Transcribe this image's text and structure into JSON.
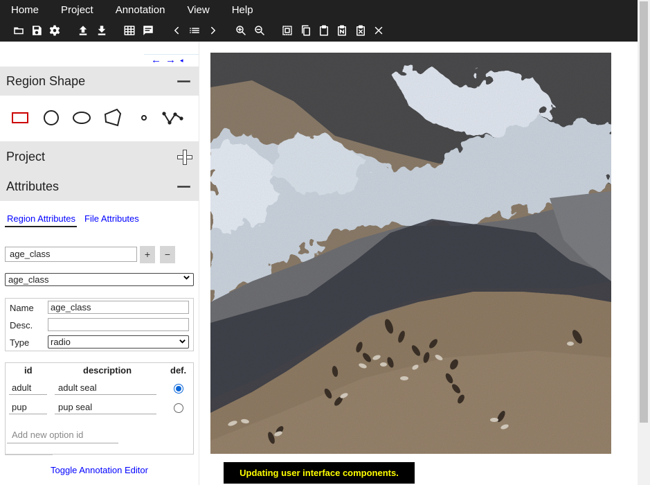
{
  "menu": {
    "items": [
      "Home",
      "Project",
      "Annotation",
      "View",
      "Help"
    ]
  },
  "toolbar": {
    "icons": [
      "open-folder-icon",
      "save-icon",
      "settings-gear-icon",
      "upload-icon",
      "download-icon",
      "grid-view-icon",
      "comment-icon",
      "chevron-left-icon",
      "list-icon",
      "chevron-right-icon",
      "zoom-in-icon",
      "zoom-out-icon",
      "select-all-icon",
      "copy-icon",
      "paste-icon",
      "paste-n-icon",
      "paste-delete-icon",
      "close-icon"
    ]
  },
  "panel_nav": {
    "prev": "←",
    "next": "→",
    "collapse": "◂"
  },
  "region_shape": {
    "title": "Region Shape",
    "shapes": [
      "rectangle",
      "circle",
      "ellipse",
      "polygon",
      "point",
      "polyline"
    ],
    "selected_color": "#cc0000"
  },
  "project": {
    "title": "Project"
  },
  "attributes": {
    "title": "Attributes",
    "tabs": [
      "Region Attributes",
      "File Attributes"
    ],
    "active_tab": "Region Attributes",
    "attr_name_input": "age_class",
    "add_label": "+",
    "remove_label": "−",
    "selected_attribute": "age_class",
    "name_label": "Name",
    "name_value": "age_class",
    "desc_label": "Desc.",
    "desc_value": "",
    "type_label": "Type",
    "type_value": "radio",
    "options_header": {
      "id": "id",
      "description": "description",
      "default": "def."
    },
    "options": [
      {
        "id": "adult",
        "description": "adult seal",
        "default": true
      },
      {
        "id": "pup",
        "description": "pup seal",
        "default": false
      }
    ],
    "new_option_placeholder": "Add new option id",
    "toggle_editor": "Toggle Annotation Editor"
  },
  "status": {
    "message": "Updating user interface components."
  }
}
